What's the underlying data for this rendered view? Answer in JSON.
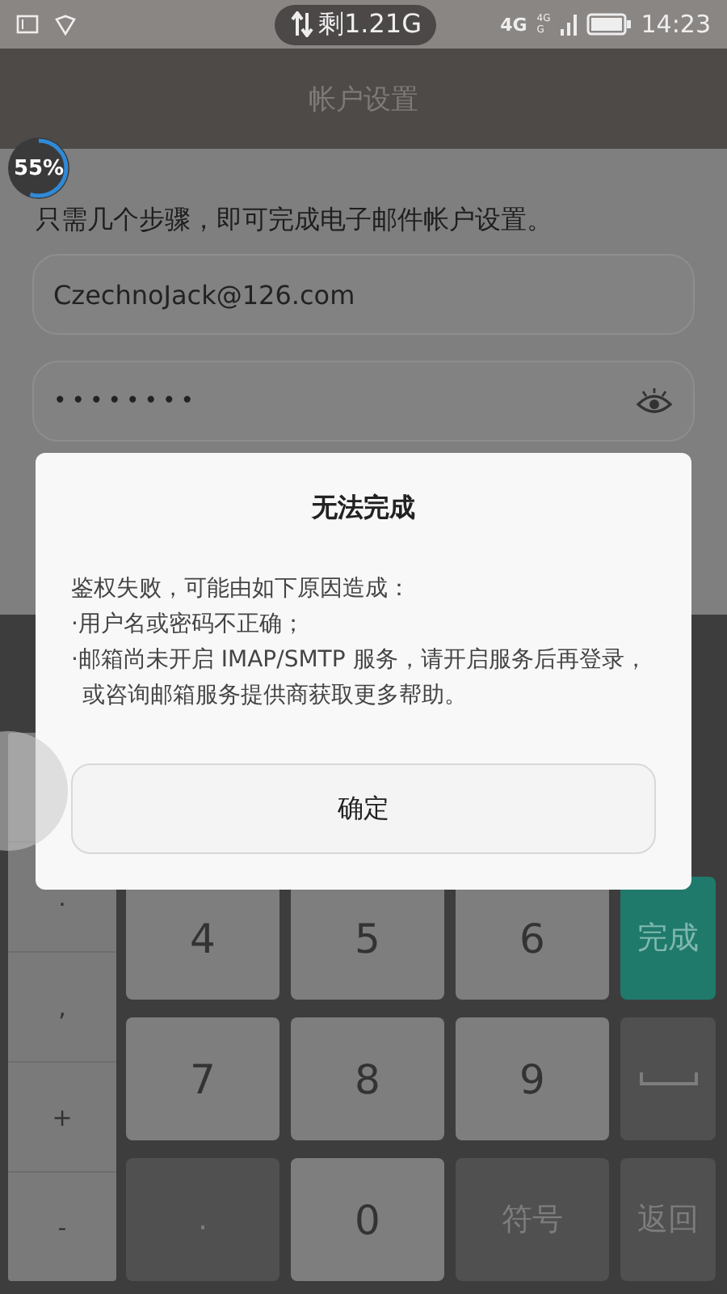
{
  "status_bar": {
    "data_remaining": "剩1.21G",
    "network": "4G",
    "signal_labels": [
      "4G",
      "G"
    ],
    "time": "14:23"
  },
  "app_bar": {
    "title": "帐户设置"
  },
  "progress_badge": {
    "label": "55%",
    "level": 0.55
  },
  "intro": "只需几个步骤，即可完成电子邮件帐户设置。",
  "email_field": {
    "value": "CzechnoJack@126.com"
  },
  "password_field": {
    "value": "••••••••"
  },
  "dialog": {
    "title": "无法完成",
    "message": "鉴权失败，可能由如下原因造成：",
    "bullets": [
      "·用户名或密码不正确；",
      "·邮箱尚未开启 IMAP/SMTP 服务，请开启服务后再登录，或咨询邮箱服务提供商获取更多帮助。"
    ],
    "button": "确定"
  },
  "keyboard": {
    "side_keys": [
      ".",
      ",",
      "+",
      "-"
    ],
    "rows": [
      [
        {
          "label": "4",
          "kind": "digit"
        },
        {
          "label": "5",
          "kind": "digit"
        },
        {
          "label": "6",
          "kind": "digit"
        },
        {
          "label": "完成",
          "kind": "action"
        }
      ],
      [
        {
          "label": "7",
          "kind": "digit"
        },
        {
          "label": "8",
          "kind": "digit"
        },
        {
          "label": "9",
          "kind": "digit"
        },
        {
          "kind": "space"
        }
      ],
      [
        {
          "label": ".",
          "kind": "function"
        },
        {
          "label": "0",
          "kind": "digit"
        },
        {
          "label": "符号",
          "kind": "function"
        },
        {
          "label": "返回",
          "kind": "function"
        }
      ]
    ]
  }
}
